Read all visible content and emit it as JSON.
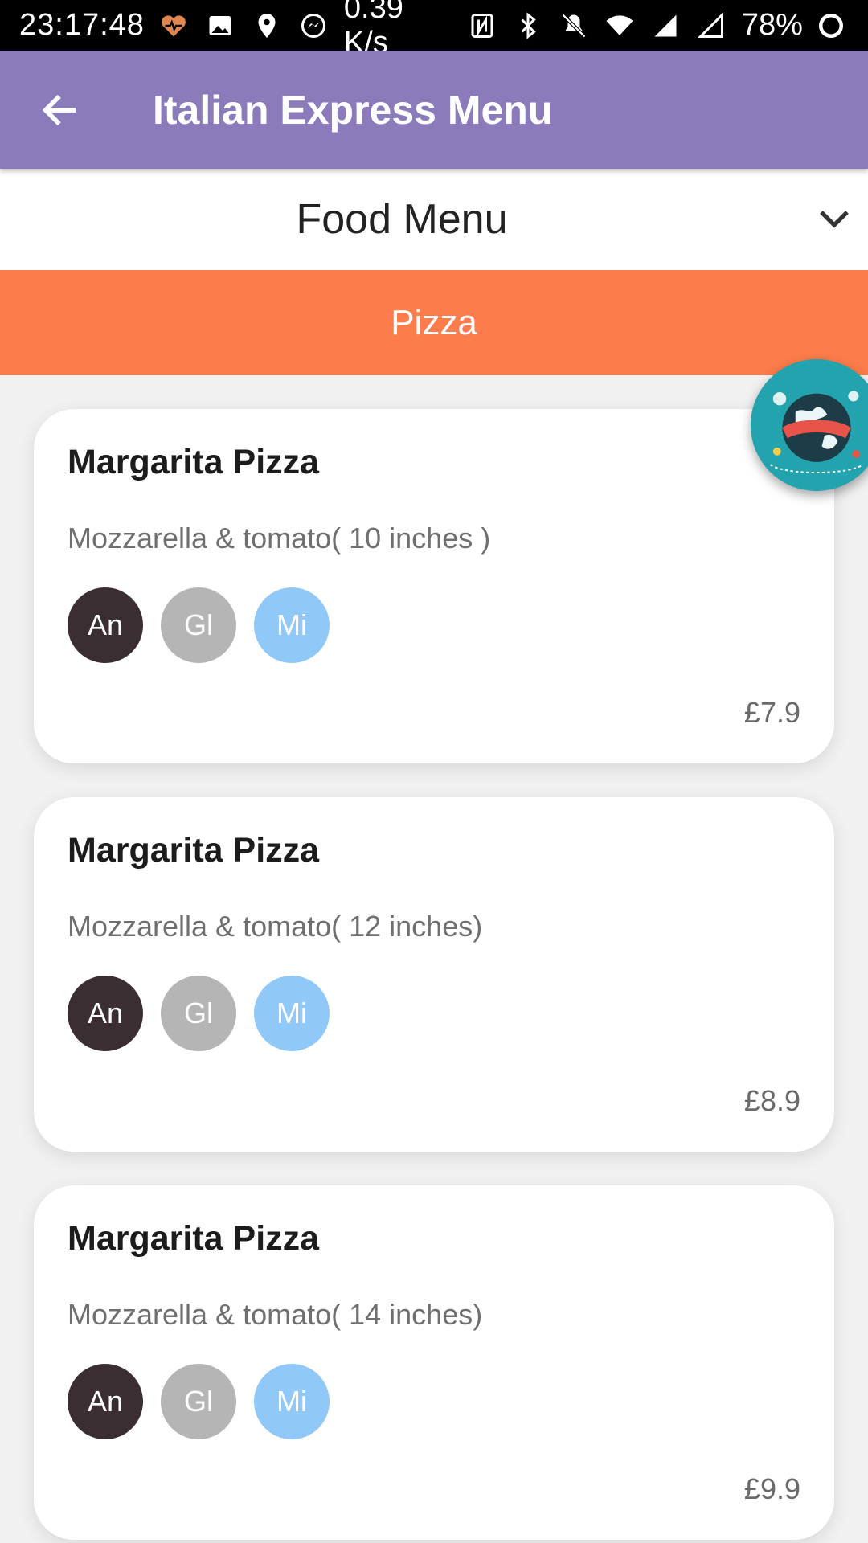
{
  "status_bar": {
    "time": "23:17:48",
    "net_speed": "0.39 K/s",
    "battery": "78%"
  },
  "app_bar": {
    "title": "Italian Express Menu",
    "back_icon": "arrow-left-icon"
  },
  "menu_select": {
    "selected": "Food Menu",
    "icon": "chevron-down-icon"
  },
  "category": {
    "label": "Pizza"
  },
  "allergen_colors": {
    "An": "#3a2e33",
    "Gl": "#b5b5b5",
    "Mi": "#90c8f7"
  },
  "items": [
    {
      "name": "Margarita Pizza",
      "description": "Mozzarella & tomato( 10 inches )",
      "allergens": [
        "An",
        "Gl",
        "Mi"
      ],
      "price": "£7.9"
    },
    {
      "name": "Margarita Pizza",
      "description": "Mozzarella & tomato( 12 inches)",
      "allergens": [
        "An",
        "Gl",
        "Mi"
      ],
      "price": "£8.9"
    },
    {
      "name": "Margarita Pizza",
      "description": "Mozzarella & tomato( 14 inches)",
      "allergens": [
        "An",
        "Gl",
        "Mi"
      ],
      "price": "£9.9"
    }
  ],
  "colors": {
    "app_bar": "#8b7bba",
    "category_bar": "#fc7c4b",
    "background": "#f1f1f1"
  }
}
